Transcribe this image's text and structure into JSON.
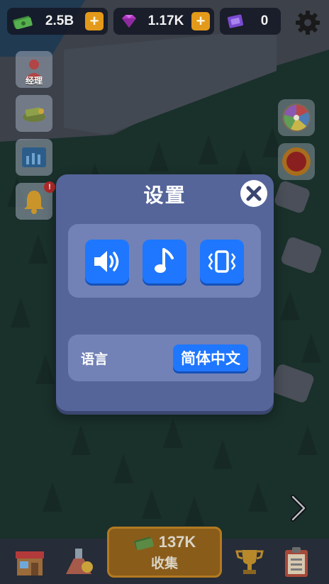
{
  "currency": {
    "money": {
      "icon": "cash-stack-icon",
      "value": "2.5B"
    },
    "gems": {
      "icon": "purple-gem-icon",
      "value": "1.17K"
    },
    "tickets": {
      "icon": "ticket-icon",
      "value": "0"
    }
  },
  "side_buttons": {
    "manager_label": "经理",
    "notification_badge": "!"
  },
  "collect": {
    "amount": "137K",
    "label": "收集"
  },
  "settings": {
    "title": "设置",
    "language_label": "语言",
    "language_value": "简体中文"
  },
  "colors": {
    "accent_blue": "#1f77ff",
    "modal_bg": "#55659a",
    "panel_bg": "#7282b6",
    "plus_orange": "#e39a1a"
  }
}
